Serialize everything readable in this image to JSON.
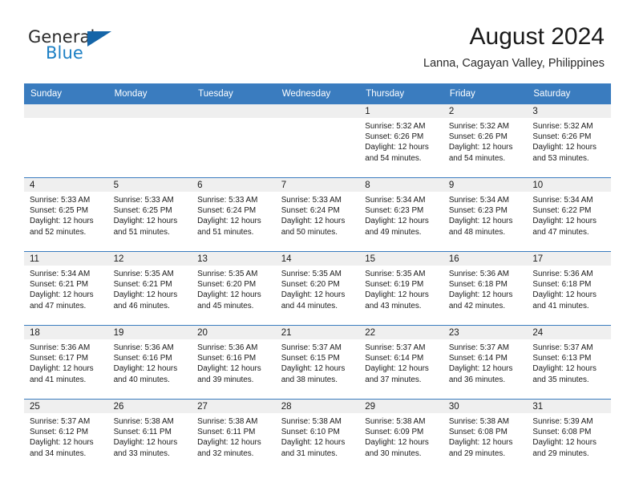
{
  "brand": {
    "name_part1": "General",
    "name_part2": "Blue",
    "flag_icon": "triangle-flag-icon"
  },
  "header": {
    "month_title": "August 2024",
    "location": "Lanna, Cagayan Valley, Philippines"
  },
  "colors": {
    "header_blue": "#3a7cbf",
    "brand_blue": "#1b7fc4",
    "daynum_bg": "#efefef",
    "cell_bg": "#ffffff",
    "text": "#1a1a1a"
  },
  "weekday_headers": [
    "Sunday",
    "Monday",
    "Tuesday",
    "Wednesday",
    "Thursday",
    "Friday",
    "Saturday"
  ],
  "weeks": [
    [
      {
        "day": "",
        "empty": true
      },
      {
        "day": "",
        "empty": true
      },
      {
        "day": "",
        "empty": true
      },
      {
        "day": "",
        "empty": true
      },
      {
        "day": "1",
        "sunrise": "Sunrise: 5:32 AM",
        "sunset": "Sunset: 6:26 PM",
        "daylight_l1": "Daylight: 12 hours",
        "daylight_l2": "and 54 minutes."
      },
      {
        "day": "2",
        "sunrise": "Sunrise: 5:32 AM",
        "sunset": "Sunset: 6:26 PM",
        "daylight_l1": "Daylight: 12 hours",
        "daylight_l2": "and 54 minutes."
      },
      {
        "day": "3",
        "sunrise": "Sunrise: 5:32 AM",
        "sunset": "Sunset: 6:26 PM",
        "daylight_l1": "Daylight: 12 hours",
        "daylight_l2": "and 53 minutes."
      }
    ],
    [
      {
        "day": "4",
        "sunrise": "Sunrise: 5:33 AM",
        "sunset": "Sunset: 6:25 PM",
        "daylight_l1": "Daylight: 12 hours",
        "daylight_l2": "and 52 minutes."
      },
      {
        "day": "5",
        "sunrise": "Sunrise: 5:33 AM",
        "sunset": "Sunset: 6:25 PM",
        "daylight_l1": "Daylight: 12 hours",
        "daylight_l2": "and 51 minutes."
      },
      {
        "day": "6",
        "sunrise": "Sunrise: 5:33 AM",
        "sunset": "Sunset: 6:24 PM",
        "daylight_l1": "Daylight: 12 hours",
        "daylight_l2": "and 51 minutes."
      },
      {
        "day": "7",
        "sunrise": "Sunrise: 5:33 AM",
        "sunset": "Sunset: 6:24 PM",
        "daylight_l1": "Daylight: 12 hours",
        "daylight_l2": "and 50 minutes."
      },
      {
        "day": "8",
        "sunrise": "Sunrise: 5:34 AM",
        "sunset": "Sunset: 6:23 PM",
        "daylight_l1": "Daylight: 12 hours",
        "daylight_l2": "and 49 minutes."
      },
      {
        "day": "9",
        "sunrise": "Sunrise: 5:34 AM",
        "sunset": "Sunset: 6:23 PM",
        "daylight_l1": "Daylight: 12 hours",
        "daylight_l2": "and 48 minutes."
      },
      {
        "day": "10",
        "sunrise": "Sunrise: 5:34 AM",
        "sunset": "Sunset: 6:22 PM",
        "daylight_l1": "Daylight: 12 hours",
        "daylight_l2": "and 47 minutes."
      }
    ],
    [
      {
        "day": "11",
        "sunrise": "Sunrise: 5:34 AM",
        "sunset": "Sunset: 6:21 PM",
        "daylight_l1": "Daylight: 12 hours",
        "daylight_l2": "and 47 minutes."
      },
      {
        "day": "12",
        "sunrise": "Sunrise: 5:35 AM",
        "sunset": "Sunset: 6:21 PM",
        "daylight_l1": "Daylight: 12 hours",
        "daylight_l2": "and 46 minutes."
      },
      {
        "day": "13",
        "sunrise": "Sunrise: 5:35 AM",
        "sunset": "Sunset: 6:20 PM",
        "daylight_l1": "Daylight: 12 hours",
        "daylight_l2": "and 45 minutes."
      },
      {
        "day": "14",
        "sunrise": "Sunrise: 5:35 AM",
        "sunset": "Sunset: 6:20 PM",
        "daylight_l1": "Daylight: 12 hours",
        "daylight_l2": "and 44 minutes."
      },
      {
        "day": "15",
        "sunrise": "Sunrise: 5:35 AM",
        "sunset": "Sunset: 6:19 PM",
        "daylight_l1": "Daylight: 12 hours",
        "daylight_l2": "and 43 minutes."
      },
      {
        "day": "16",
        "sunrise": "Sunrise: 5:36 AM",
        "sunset": "Sunset: 6:18 PM",
        "daylight_l1": "Daylight: 12 hours",
        "daylight_l2": "and 42 minutes."
      },
      {
        "day": "17",
        "sunrise": "Sunrise: 5:36 AM",
        "sunset": "Sunset: 6:18 PM",
        "daylight_l1": "Daylight: 12 hours",
        "daylight_l2": "and 41 minutes."
      }
    ],
    [
      {
        "day": "18",
        "sunrise": "Sunrise: 5:36 AM",
        "sunset": "Sunset: 6:17 PM",
        "daylight_l1": "Daylight: 12 hours",
        "daylight_l2": "and 41 minutes."
      },
      {
        "day": "19",
        "sunrise": "Sunrise: 5:36 AM",
        "sunset": "Sunset: 6:16 PM",
        "daylight_l1": "Daylight: 12 hours",
        "daylight_l2": "and 40 minutes."
      },
      {
        "day": "20",
        "sunrise": "Sunrise: 5:36 AM",
        "sunset": "Sunset: 6:16 PM",
        "daylight_l1": "Daylight: 12 hours",
        "daylight_l2": "and 39 minutes."
      },
      {
        "day": "21",
        "sunrise": "Sunrise: 5:37 AM",
        "sunset": "Sunset: 6:15 PM",
        "daylight_l1": "Daylight: 12 hours",
        "daylight_l2": "and 38 minutes."
      },
      {
        "day": "22",
        "sunrise": "Sunrise: 5:37 AM",
        "sunset": "Sunset: 6:14 PM",
        "daylight_l1": "Daylight: 12 hours",
        "daylight_l2": "and 37 minutes."
      },
      {
        "day": "23",
        "sunrise": "Sunrise: 5:37 AM",
        "sunset": "Sunset: 6:14 PM",
        "daylight_l1": "Daylight: 12 hours",
        "daylight_l2": "and 36 minutes."
      },
      {
        "day": "24",
        "sunrise": "Sunrise: 5:37 AM",
        "sunset": "Sunset: 6:13 PM",
        "daylight_l1": "Daylight: 12 hours",
        "daylight_l2": "and 35 minutes."
      }
    ],
    [
      {
        "day": "25",
        "sunrise": "Sunrise: 5:37 AM",
        "sunset": "Sunset: 6:12 PM",
        "daylight_l1": "Daylight: 12 hours",
        "daylight_l2": "and 34 minutes."
      },
      {
        "day": "26",
        "sunrise": "Sunrise: 5:38 AM",
        "sunset": "Sunset: 6:11 PM",
        "daylight_l1": "Daylight: 12 hours",
        "daylight_l2": "and 33 minutes."
      },
      {
        "day": "27",
        "sunrise": "Sunrise: 5:38 AM",
        "sunset": "Sunset: 6:11 PM",
        "daylight_l1": "Daylight: 12 hours",
        "daylight_l2": "and 32 minutes."
      },
      {
        "day": "28",
        "sunrise": "Sunrise: 5:38 AM",
        "sunset": "Sunset: 6:10 PM",
        "daylight_l1": "Daylight: 12 hours",
        "daylight_l2": "and 31 minutes."
      },
      {
        "day": "29",
        "sunrise": "Sunrise: 5:38 AM",
        "sunset": "Sunset: 6:09 PM",
        "daylight_l1": "Daylight: 12 hours",
        "daylight_l2": "and 30 minutes."
      },
      {
        "day": "30",
        "sunrise": "Sunrise: 5:38 AM",
        "sunset": "Sunset: 6:08 PM",
        "daylight_l1": "Daylight: 12 hours",
        "daylight_l2": "and 29 minutes."
      },
      {
        "day": "31",
        "sunrise": "Sunrise: 5:39 AM",
        "sunset": "Sunset: 6:08 PM",
        "daylight_l1": "Daylight: 12 hours",
        "daylight_l2": "and 29 minutes."
      }
    ]
  ]
}
